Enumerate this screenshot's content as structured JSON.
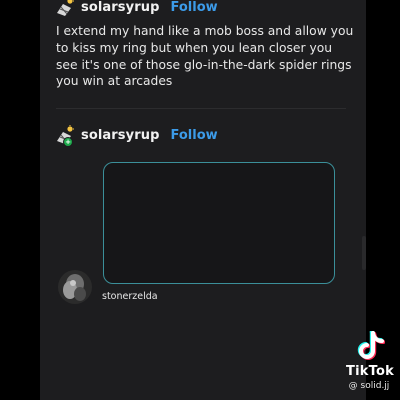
{
  "colors": {
    "post_background": "#1d1d1f",
    "follow_link": "#3c9be8",
    "reply_box_border": "#3b8f99",
    "badge_green": "#1ca84a"
  },
  "post": {
    "author": "solarsyrup",
    "follow_label": "Follow",
    "text": "I extend my hand like a mob boss and allow you to kiss my ring but when you lean closer you see it's one of those glo-in-the-dark spider rings you win at arcades",
    "avatar_icon": "solar-panel-icon"
  },
  "reply": {
    "author": "solarsyrup",
    "follow_label": "Follow",
    "avatar_icon": "solar-panel-icon",
    "badge_icon": "plus-badge-icon"
  },
  "comment": {
    "author": "stonerzelda"
  },
  "watermark": {
    "brand": "TikTok",
    "handle": "@ solid.jj",
    "logo_icon": "tiktok-logo-icon"
  }
}
